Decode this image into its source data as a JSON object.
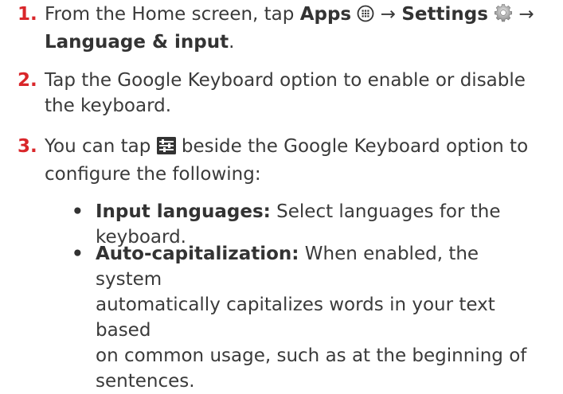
{
  "steps": [
    {
      "number": "1.",
      "text_a": "From the Home screen, tap ",
      "apps": "Apps",
      "arrow1": " → ",
      "settings": "Settings",
      "arrow2": " →",
      "target": "Language & input",
      "end": "."
    },
    {
      "number": "2.",
      "line1": "Tap the Google Keyboard option to enable or disable",
      "line2": "the keyboard."
    },
    {
      "number": "3.",
      "text_a": "You can tap ",
      "text_b": " beside the Google Keyboard option to",
      "line2": "configure the following:"
    }
  ],
  "bullets": [
    {
      "marker": "•",
      "term": "Input languages:",
      "line1": " Select languages for the",
      "line2": "keyboard."
    },
    {
      "marker": "•",
      "term": "Auto-capitalization:",
      "line1": " When enabled, the system",
      "line2": "automatically capitalizes words in your text based",
      "line3": "on common usage, such as at the beginning of",
      "line4": "sentences."
    }
  ],
  "icons": {
    "apps": "apps-grid-icon",
    "settings": "settings-gear-icon",
    "keyboard_settings": "keyboard-settings-sliders-icon"
  },
  "colors": {
    "step_number": "#d9262a",
    "body_text": "#3a3a3a"
  }
}
